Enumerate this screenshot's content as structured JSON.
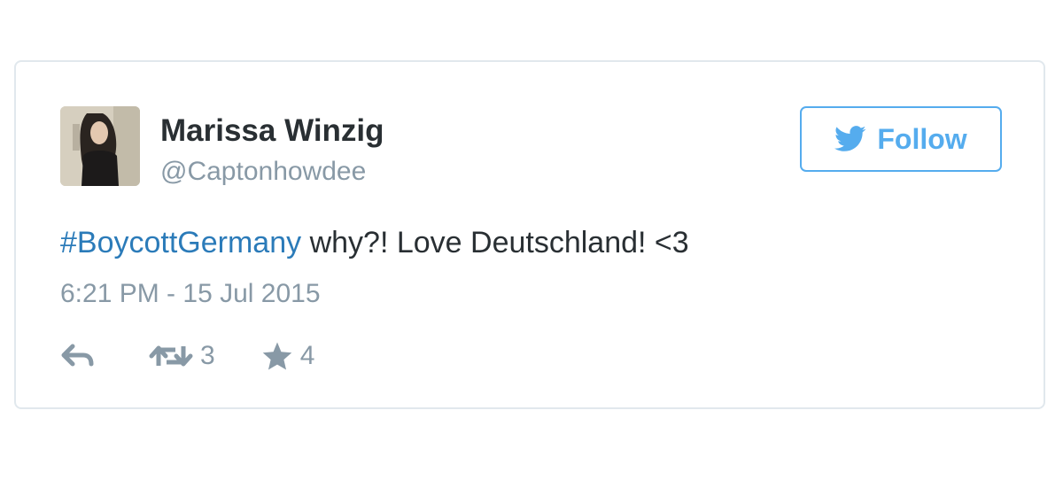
{
  "user": {
    "display_name": "Marissa Winzig",
    "screen_name": "@Captonhowdee"
  },
  "follow_button": {
    "label": "Follow",
    "icon": "twitter-bird-icon"
  },
  "tweet": {
    "hashtag": "#BoycottGermany",
    "text": " why?! Love Deutschland! <3",
    "timestamp": "6:21 PM - 15 Jul 2015"
  },
  "actions": {
    "reply_icon": "reply-icon",
    "retweet_icon": "retweet-icon",
    "retweet_count": "3",
    "favorite_icon": "star-icon",
    "favorite_count": "4"
  },
  "colors": {
    "accent": "#55acee",
    "link": "#2b7bb9",
    "text": "#292f33",
    "muted": "#8899a6",
    "border": "#e1e8ed"
  }
}
